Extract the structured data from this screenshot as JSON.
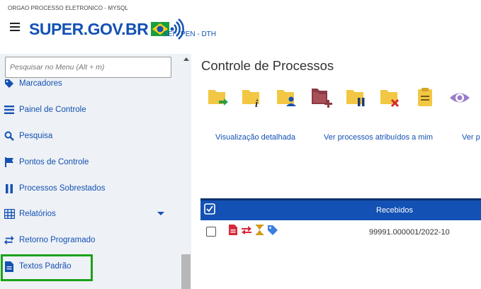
{
  "header": {
    "org_label": "ORGAO PROCESSO ELETRONICO - MYSQL",
    "logo_text": "SUPER.GOV.BR",
    "unit_label": "SEI - PEN - DTH"
  },
  "sidebar": {
    "search_placeholder": "Pesquisar no Menu (Alt + m)",
    "items": [
      {
        "label": "Marcadores",
        "icon": "tag-icon"
      },
      {
        "label": "Painel de Controle",
        "icon": "list-icon"
      },
      {
        "label": "Pesquisa",
        "icon": "search-icon"
      },
      {
        "label": "Pontos de Controle",
        "icon": "flag-icon"
      },
      {
        "label": "Processos Sobrestados",
        "icon": "pause-icon"
      },
      {
        "label": "Relatórios",
        "icon": "table-icon"
      },
      {
        "label": "Retorno Programado",
        "icon": "swap-icon"
      },
      {
        "label": "Textos Padrão",
        "icon": "document-icon"
      }
    ]
  },
  "main": {
    "title": "Controle de Processos",
    "toolbar_icons": [
      "folder-send-icon",
      "folder-info-icon",
      "folder-user-icon",
      "folder-add-icon",
      "folder-pause-icon",
      "folder-cancel-icon",
      "clipboard-icon",
      "eye-icon"
    ],
    "view_links": [
      "Visualização detalhada",
      "Ver processos atribuídos a mim",
      "Ver p"
    ],
    "table": {
      "header": "Recebidos",
      "rows": [
        {
          "process_number": "99991.000001/2022-10"
        }
      ]
    }
  },
  "colors": {
    "brand_blue": "#1351b4",
    "folder_yellow": "#f2c744",
    "highlight_green": "#1aa31a"
  }
}
